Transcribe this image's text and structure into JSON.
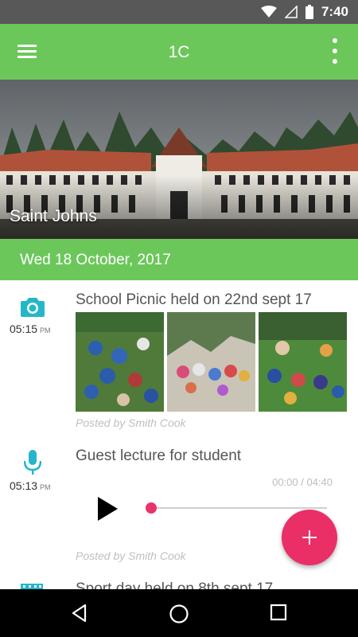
{
  "status_bar": {
    "time": "7:40"
  },
  "app_bar": {
    "title": "1C"
  },
  "header": {
    "school_name": "Saint Johns"
  },
  "date_header": "Wed 18 October, 2017",
  "feed": [
    {
      "type": "photos",
      "icon": "camera-icon",
      "time": "05:15",
      "ampm": "PM",
      "title": "School Picnic held on 22nd sept 17",
      "posted_by": "Posted by Smith Cook",
      "photo_count": 3
    },
    {
      "type": "audio",
      "icon": "microphone-icon",
      "time": "05:13",
      "ampm": "PM",
      "title": "Guest lecture for student",
      "duration": "00:00 / 04:40",
      "progress": 0,
      "posted_by": "Posted by Smith Cook"
    },
    {
      "type": "video",
      "icon": "film-icon",
      "title": "Sport day held on 8th sept 17"
    }
  ],
  "colors": {
    "primary": "#6cc75b",
    "accent": "#ea2f66",
    "icon_teal": "#25b6c9",
    "status_bar": "#585858"
  }
}
